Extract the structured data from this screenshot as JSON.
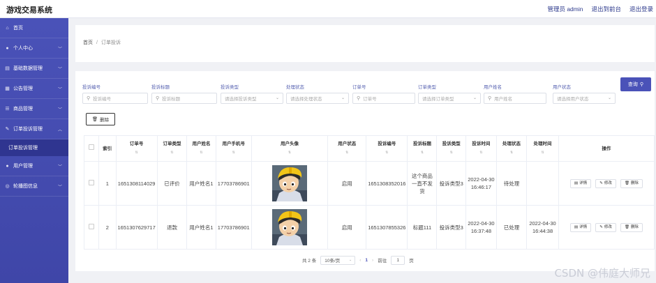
{
  "app_title": "游戏交易系统",
  "header": {
    "user": "管理员 admin",
    "to_front": "退出到前台",
    "logout": "退出登录"
  },
  "sidebar": {
    "items": [
      {
        "label": "首页",
        "icon": "home-icon",
        "glyph": "⌂",
        "expandable": false
      },
      {
        "label": "个人中心",
        "icon": "user-icon",
        "glyph": "●",
        "expandable": true
      },
      {
        "label": "基础数据管理",
        "icon": "database-icon",
        "glyph": "▤",
        "expandable": true
      },
      {
        "label": "公告管理",
        "icon": "notice-icon",
        "glyph": "▦",
        "expandable": true
      },
      {
        "label": "商品管理",
        "icon": "goods-icon",
        "glyph": "☰",
        "expandable": true
      },
      {
        "label": "订单投诉管理",
        "icon": "complaint-icon",
        "glyph": "✎",
        "expandable": true,
        "expanded": true
      },
      {
        "label": "用户管理",
        "icon": "users-icon",
        "glyph": "●",
        "expandable": true
      },
      {
        "label": "轮播图信息",
        "icon": "carousel-icon",
        "glyph": "◎",
        "expandable": true
      }
    ],
    "active_sub": "订单投诉管理"
  },
  "breadcrumb": {
    "home": "首页",
    "sep": "/",
    "current": "订单投诉"
  },
  "filters": [
    {
      "label": "投诉编号",
      "placeholder": "投诉编号",
      "kind": "text"
    },
    {
      "label": "投诉标题",
      "placeholder": "投诉标题",
      "kind": "text"
    },
    {
      "label": "投诉类型",
      "placeholder": "请选择投诉类型",
      "kind": "select"
    },
    {
      "label": "处理状态",
      "placeholder": "请选择处理状态",
      "kind": "select"
    },
    {
      "label": "订单号",
      "placeholder": "订单号",
      "kind": "text"
    },
    {
      "label": "订单类型",
      "placeholder": "请选择订单类型",
      "kind": "select"
    },
    {
      "label": "用户姓名",
      "placeholder": "用户姓名",
      "kind": "text"
    },
    {
      "label": "用户状态",
      "placeholder": "请选择用户状态",
      "kind": "select"
    }
  ],
  "buttons": {
    "query": "查询",
    "delete": "删除"
  },
  "table": {
    "columns": [
      {
        "label": "",
        "sort": false
      },
      {
        "label": "索引",
        "sort": false
      },
      {
        "label": "订单号",
        "sort": true
      },
      {
        "label": "订单类型",
        "sort": true
      },
      {
        "label": "用户姓名",
        "sort": true
      },
      {
        "label": "用户手机号",
        "sort": true
      },
      {
        "label": "用户头像",
        "sort": true
      },
      {
        "label": "用户状态",
        "sort": true
      },
      {
        "label": "投诉编号",
        "sort": true
      },
      {
        "label": "投诉标题",
        "sort": true
      },
      {
        "label": "投诉类型",
        "sort": true
      },
      {
        "label": "投诉时间",
        "sort": true
      },
      {
        "label": "处理状态",
        "sort": true
      },
      {
        "label": "处理时间",
        "sort": true
      },
      {
        "label": "操作",
        "sort": false
      }
    ],
    "rows": [
      {
        "index": "1",
        "order_no": "1651308114029",
        "order_type": "已评价",
        "user_name": "用户姓名1",
        "phone": "17703786901",
        "user_status": "启用",
        "complaint_no": "1651308352016",
        "title": "这个商品一直不发货",
        "complaint_type": "投诉类型3",
        "complaint_time": "2022-04-30 16:46:17",
        "handle_status": "待处理",
        "handle_time": ""
      },
      {
        "index": "2",
        "order_no": "1651307629717",
        "order_type": "退款",
        "user_name": "用户姓名1",
        "phone": "17703786901",
        "user_status": "启用",
        "complaint_no": "1651307855326",
        "title": "标题111",
        "complaint_type": "投诉类型3",
        "complaint_time": "2022-04-30 16:37:48",
        "handle_status": "已处理",
        "handle_time": "2022-04-30 16:44:38"
      }
    ],
    "actions": {
      "detail": "详情",
      "edit": "修改",
      "delete": "删除"
    }
  },
  "pagination": {
    "total": "共 2 条",
    "page_size": "10条/页",
    "current": "1",
    "goto_label": "前往",
    "goto_value": "1",
    "page_unit": "页"
  },
  "watermark": "CSDN @伟庭大师兄"
}
